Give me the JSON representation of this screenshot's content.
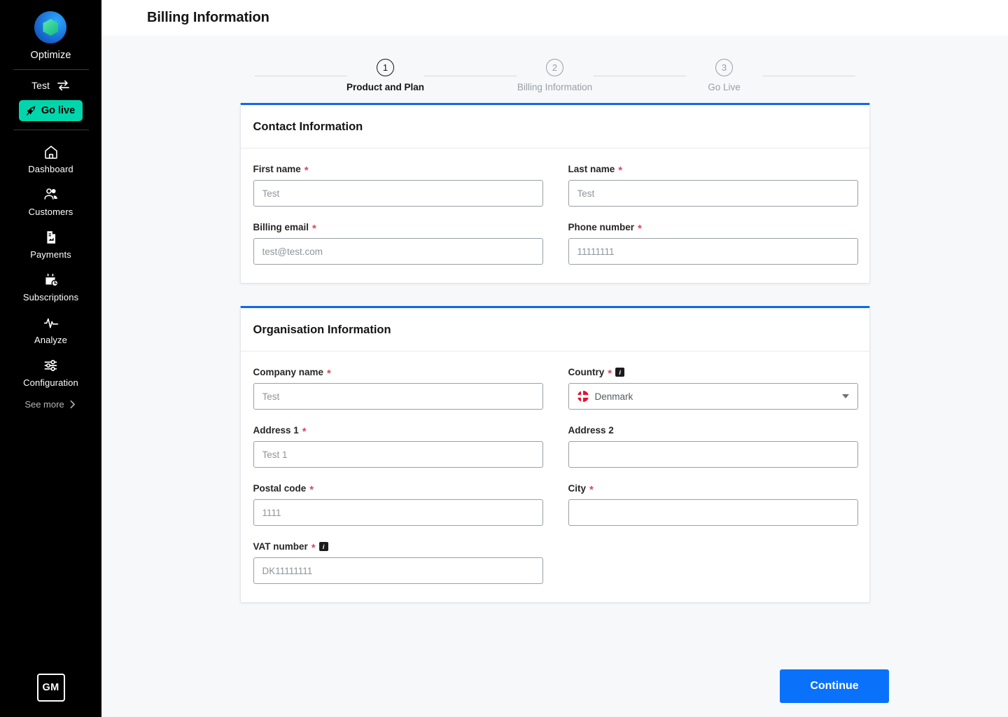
{
  "sidebar": {
    "brand": {
      "name": "Optimize",
      "logo_icon": "optimize-logo"
    },
    "environment": {
      "label": "Test",
      "icon": "swap-arrows-icon"
    },
    "go_live": {
      "label": "Go live",
      "icon": "rocket-icon",
      "color": "#00d6ac"
    },
    "nav_items": [
      {
        "label": "Dashboard",
        "icon": "home-icon"
      },
      {
        "label": "Customers",
        "icon": "people-icon"
      },
      {
        "label": "Payments",
        "icon": "document-chart-icon"
      },
      {
        "label": "Subscriptions",
        "icon": "calendar-clock-icon"
      },
      {
        "label": "Analyze",
        "icon": "pulse-icon"
      },
      {
        "label": "Configuration",
        "icon": "sliders-icon"
      }
    ],
    "see_more": {
      "label": "See more",
      "icon": "chevron-right-icon"
    },
    "avatar": {
      "initials": "GM"
    }
  },
  "header": {
    "title": "Billing Information"
  },
  "stepper": {
    "steps": [
      {
        "number": "1",
        "label": "Product and Plan",
        "state": "active"
      },
      {
        "number": "2",
        "label": "Billing Information",
        "state": "inactive"
      },
      {
        "number": "3",
        "label": "Go Live",
        "state": "inactive"
      }
    ],
    "accent": "#151515"
  },
  "contact_card": {
    "title": "Contact Information",
    "fields": {
      "first_name": {
        "label": "First name",
        "required": "*",
        "placeholder": "Test",
        "value": ""
      },
      "last_name": {
        "label": "Last name",
        "required": "*",
        "placeholder": "Test",
        "value": ""
      },
      "billing_email": {
        "label": "Billing email",
        "required": "*",
        "placeholder": "test@test.com",
        "value": ""
      },
      "phone_number": {
        "label": "Phone number",
        "required": "*",
        "placeholder": "11111111",
        "value": ""
      }
    }
  },
  "organisation_card": {
    "title": "Organisation Information",
    "fields": {
      "company_name": {
        "label": "Company name",
        "required": "*",
        "placeholder": "Test",
        "value": ""
      },
      "country": {
        "label": "Country",
        "required": "*",
        "info": "i",
        "selected": "Denmark",
        "flag": "denmark-flag-icon"
      },
      "address_1": {
        "label": "Address 1",
        "required": "*",
        "placeholder": "Test 1",
        "value": ""
      },
      "address_2": {
        "label": "Address 2",
        "required": "",
        "placeholder": "",
        "value": ""
      },
      "postal_code": {
        "label": "Postal code",
        "required": "*",
        "placeholder": "1111",
        "value": ""
      },
      "city": {
        "label": "City",
        "required": "*",
        "placeholder": "",
        "value": ""
      },
      "vat_number": {
        "label": "VAT number",
        "required": "*",
        "info": "i",
        "placeholder": "DK11111111",
        "value": ""
      }
    }
  },
  "footer": {
    "continue_label": "Continue",
    "continue_color": "#0a71fb"
  }
}
